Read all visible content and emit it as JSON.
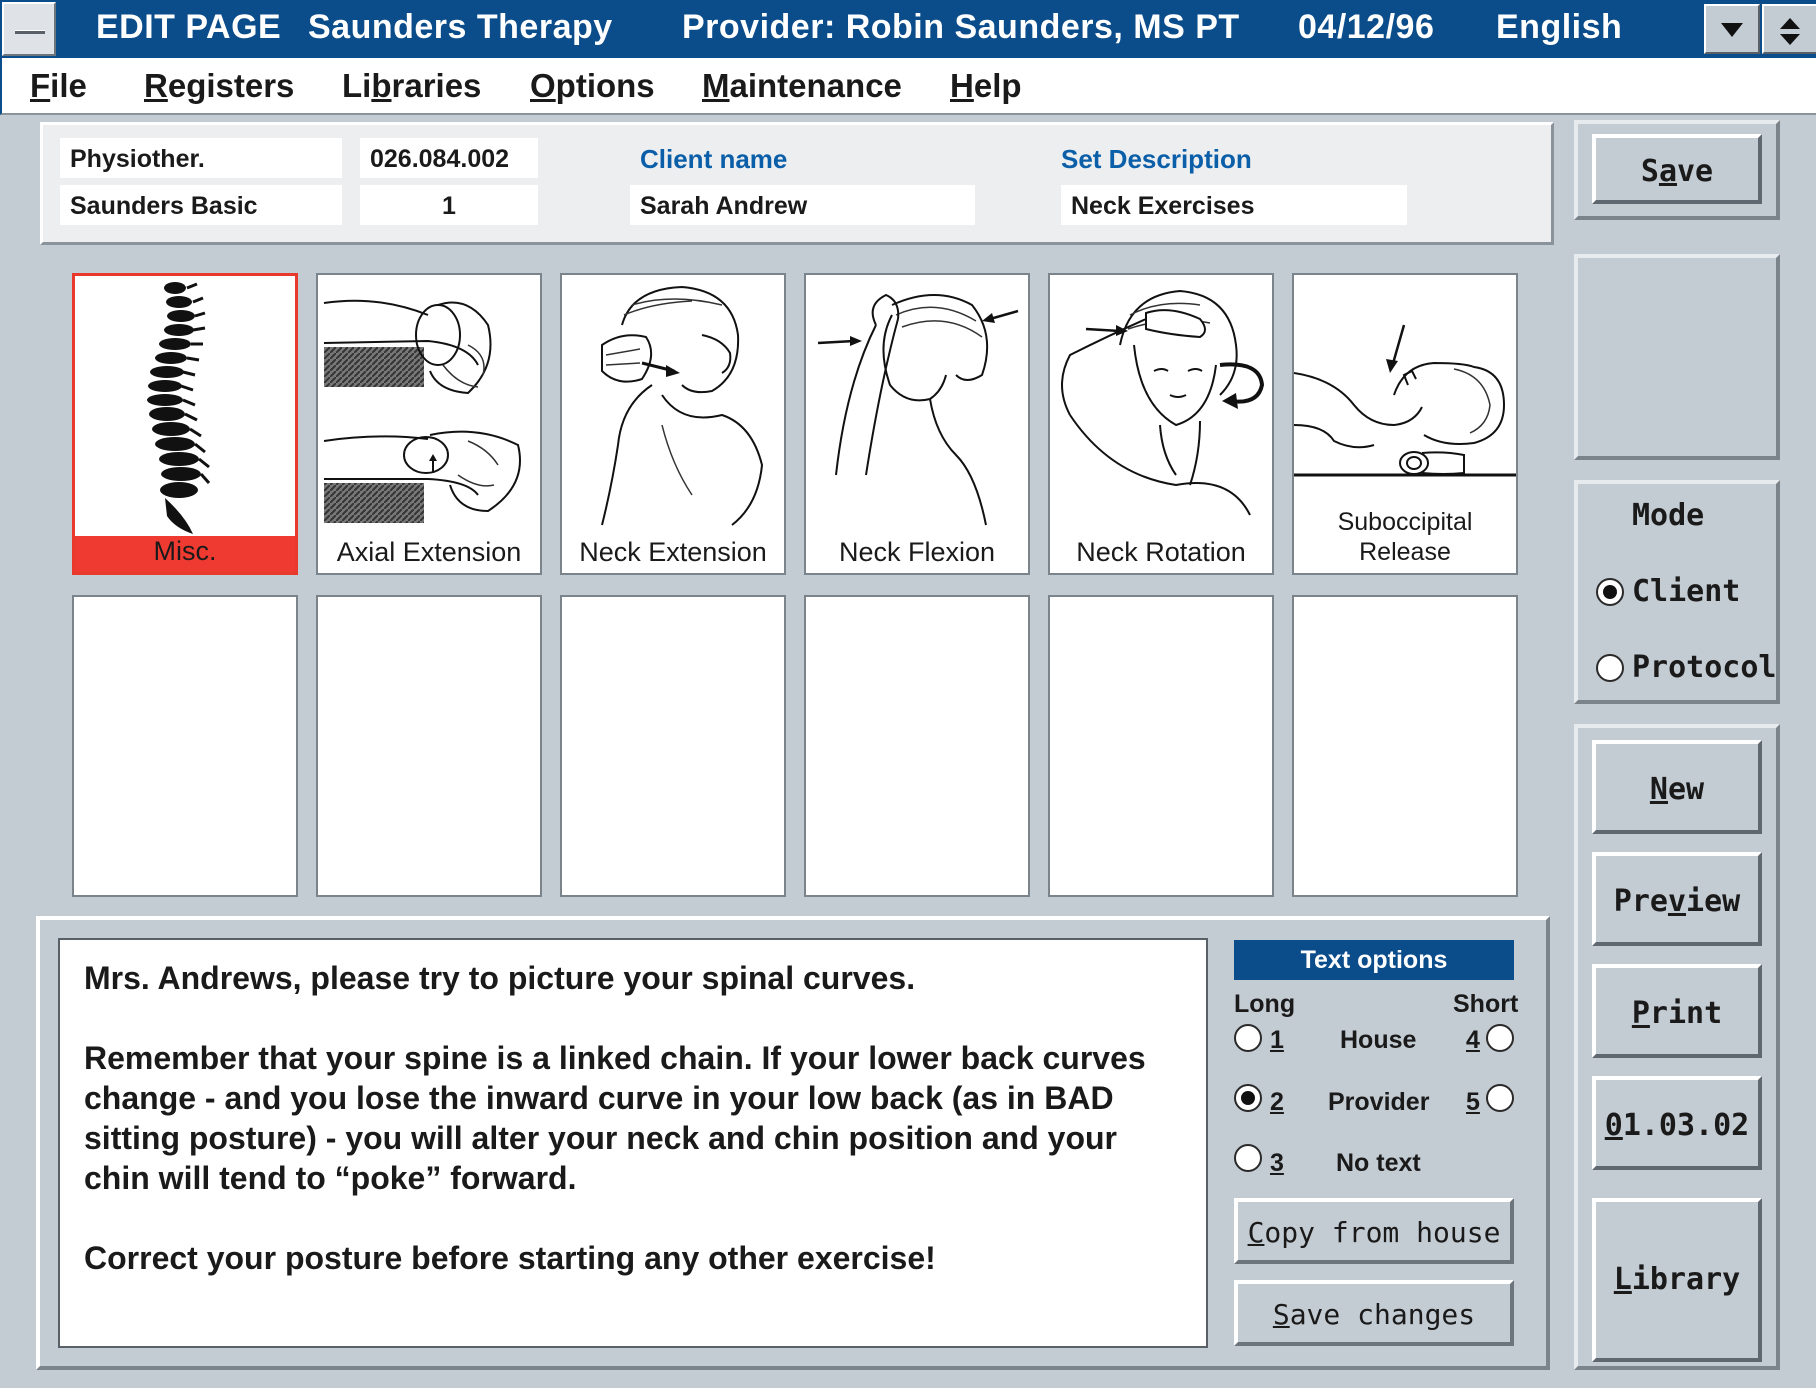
{
  "titlebar": {
    "page": "EDIT PAGE",
    "clinic": "Saunders Therapy",
    "provider": "Provider: Robin Saunders, MS PT",
    "date": "04/12/96",
    "language": "English"
  },
  "menu": [
    {
      "pre": "",
      "u": "F",
      "post": "ile"
    },
    {
      "pre": "",
      "u": "R",
      "post": "egisters"
    },
    {
      "pre": "Li",
      "u": "b",
      "post": "raries"
    },
    {
      "pre": "",
      "u": "O",
      "post": "ptions"
    },
    {
      "pre": "",
      "u": "M",
      "post": "aintenance"
    },
    {
      "pre": "",
      "u": "H",
      "post": "elp"
    }
  ],
  "info": {
    "category": "Physiother.",
    "library": "Saunders Basic",
    "code": "026.084.002",
    "page_number": "1",
    "client_label": "Client name",
    "client_value": "Sarah Andrew",
    "set_label": "Set Description",
    "set_value": "Neck Exercises"
  },
  "tiles": [
    {
      "caption": "Misc.",
      "selected": true
    },
    {
      "caption": "Axial Extension"
    },
    {
      "caption": "Neck Extension"
    },
    {
      "caption": "Neck Flexion"
    },
    {
      "caption": "Neck Rotation"
    },
    {
      "caption_line1": "Suboccipital",
      "caption_line2": "Release"
    }
  ],
  "text": {
    "p1": "Mrs. Andrews, please try to picture your spinal curves.",
    "p2": "Remember that your spine is a linked chain.  If your lower back curves change - and you lose the inward curve in your low back (as in BAD sitting posture) - you will alter your neck and chin position and your chin will tend to “poke” forward.",
    "p3": "Correct your posture before starting any other exercise!"
  },
  "text_options": {
    "header": "Text options",
    "long": "Long",
    "short": "Short",
    "rows": [
      {
        "num": "1",
        "label": "House",
        "short_num": "4"
      },
      {
        "num": "2",
        "label": "Provider",
        "short_num": "5"
      },
      {
        "num": "3",
        "label": "No text"
      }
    ],
    "selected_long": "2",
    "copy_btn": {
      "u": "C",
      "post": "opy from house"
    },
    "save_btn": {
      "u": "S",
      "post": "ave changes"
    }
  },
  "right": {
    "save": {
      "pre": "S",
      "u": "a",
      "post": "ve"
    },
    "mode_label": "Mode",
    "mode_client": "Client",
    "mode_protocol": "Protocol",
    "mode_selected": "Client",
    "new": {
      "pre": "",
      "u": "N",
      "post": "ew"
    },
    "preview": {
      "pre": "Pre",
      "u": "v",
      "post": "iew"
    },
    "print": {
      "pre": "",
      "u": "P",
      "post": "rint"
    },
    "version": {
      "pre": "",
      "u": "0",
      "post": "1.03.02"
    },
    "library": {
      "pre": "",
      "u": "L",
      "post": "ibrary"
    }
  },
  "icons": [
    "system-menu-icon",
    "dropdown-arrow-icon",
    "scroll-arrows-icon",
    "spine-icon",
    "axial-extension-illustration",
    "neck-extension-illustration",
    "neck-flexion-illustration",
    "neck-rotation-illustration",
    "suboccipital-release-illustration"
  ]
}
